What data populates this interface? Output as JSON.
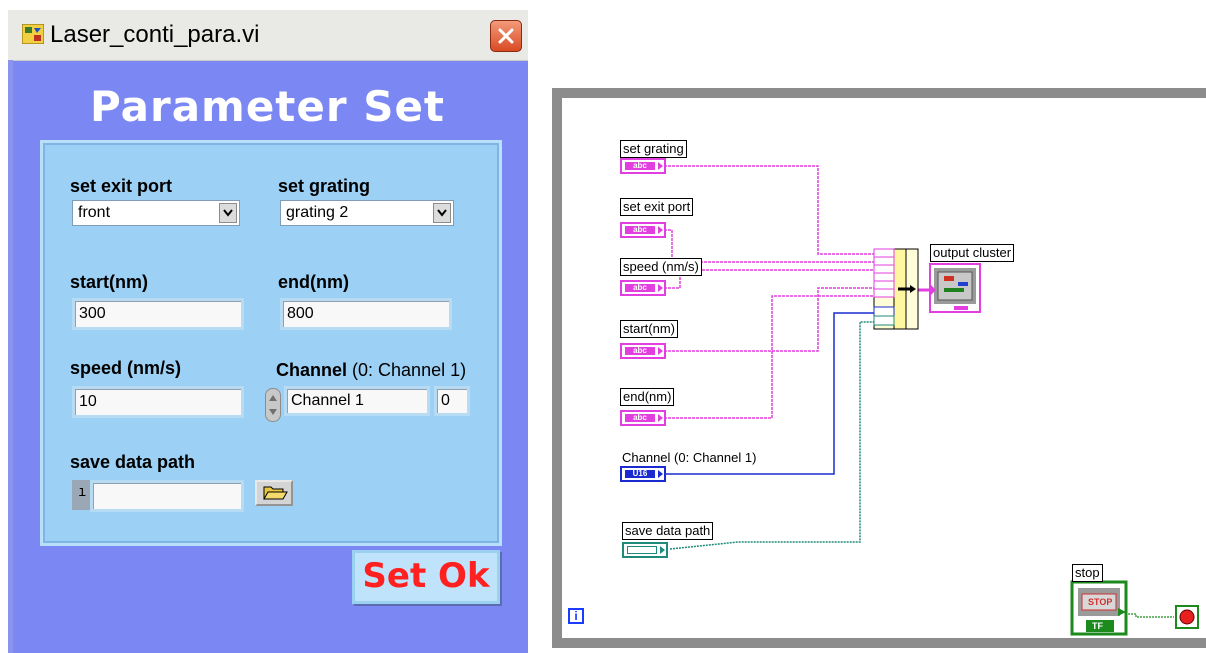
{
  "window": {
    "title": "Laser_conti_para.vi"
  },
  "panel": {
    "heading": "Parameter Set",
    "exit_port": {
      "label": "set  exit port",
      "value": "front"
    },
    "grating": {
      "label": "set  grating",
      "value": "grating 2"
    },
    "start": {
      "label": "start(nm)",
      "value": "300"
    },
    "end": {
      "label": "end(nm)",
      "value": "800"
    },
    "speed": {
      "label": "speed  (nm/s)",
      "value": "10"
    },
    "channel": {
      "label": "Channel",
      "label_suffix": "(0: Channel 1)",
      "value": "Channel 1",
      "index": "0"
    },
    "save_path": {
      "label": "save data path",
      "value": ""
    },
    "set_ok": "Set Ok"
  },
  "diagram": {
    "labels": {
      "set_grating": "set  grating",
      "set_exit_port": "set  exit port",
      "speed": "speed  (nm/s)",
      "start": "start(nm)",
      "end": "end(nm)",
      "channel": "Channel (0: Channel 1)",
      "save_path": "save data path",
      "output_cluster": "output cluster",
      "stop": "stop"
    },
    "terminal_text": {
      "string": "abc",
      "u16": "U16",
      "stop": "STOP",
      "tf": "TF",
      "loop_index": "i"
    },
    "colors": {
      "string_wire": "#e23ee0",
      "u16_wire": "#1a2ccf",
      "path_wire": "#1f8a7a",
      "bool_wire": "#1c8a1c"
    }
  }
}
